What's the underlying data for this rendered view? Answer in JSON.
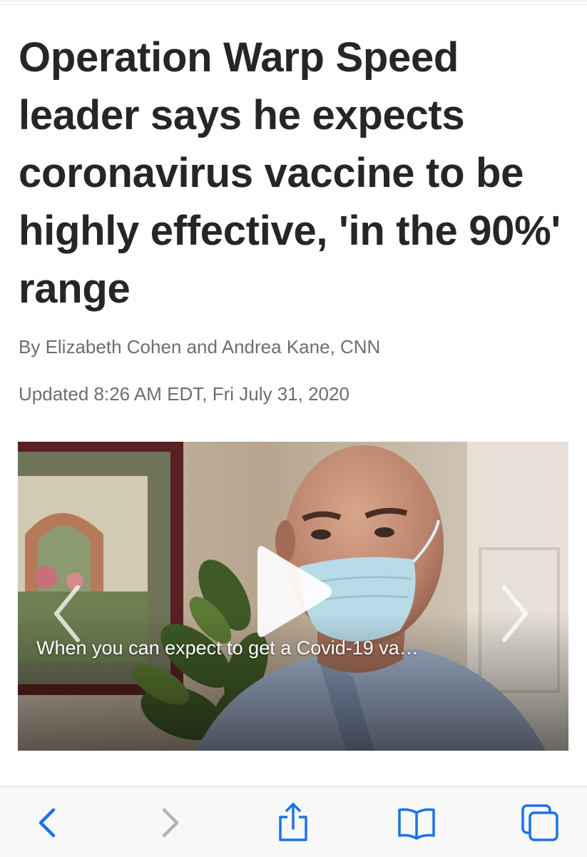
{
  "article": {
    "headline": "Operation Warp Speed leader says he expects coronavirus vaccine to be highly effective, 'in the 90%' range",
    "byline": "By Elizabeth Cohen and Andrea Kane, CNN",
    "updated": "Updated 8:26 AM EDT, Fri July 31, 2020"
  },
  "video": {
    "caption": "When you can expect to get a Covid-19 va…"
  },
  "toolbar": {
    "items": [
      "back",
      "forward",
      "share",
      "bookmarks",
      "tabs"
    ],
    "tint": "#1a73e8",
    "disabled_tint": "#b3b3b3"
  }
}
